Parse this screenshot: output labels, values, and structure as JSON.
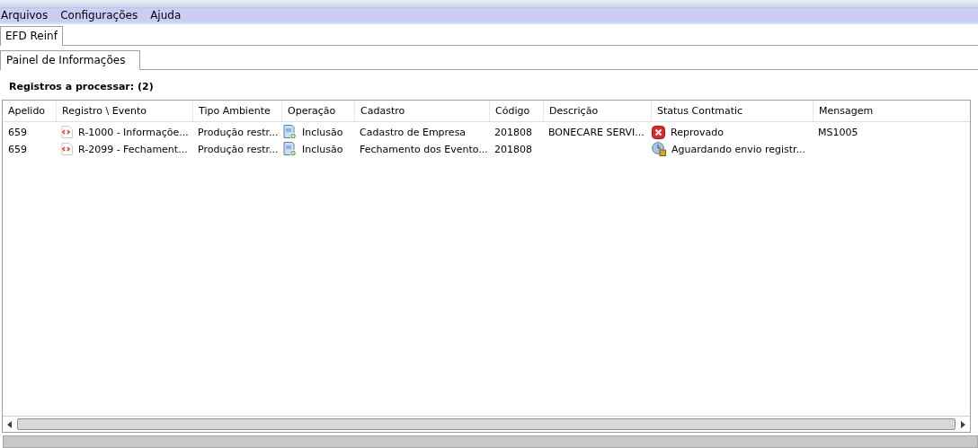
{
  "menu": [
    {
      "label": "Arquivos"
    },
    {
      "label": "Configurações"
    },
    {
      "label": "Ajuda"
    }
  ],
  "main_tabs": [
    {
      "label": "EFD Reinf",
      "selected": true
    }
  ],
  "sub_tabs": [
    {
      "label": "Painel de Informações",
      "selected": true
    }
  ],
  "summary": "Registros a processar: (2)",
  "table": {
    "columns": [
      "Apelido",
      "Registro \\ Evento",
      "Tipo Ambiente",
      "Operação",
      "Cadastro",
      "Código",
      "Descrição",
      "Status Contmatic",
      "Mensagem"
    ],
    "rows": [
      {
        "apelido": "659",
        "evento": "R-1000 - Informaçõe...",
        "ambiente": "Produção restr...",
        "operacao": "Inclusão",
        "cadastro": "Cadastro de Empresa",
        "codigo": "201808",
        "descricao": "BONECARE SERVI...",
        "status": {
          "kind": "error",
          "label": "Reprovado"
        },
        "mensagem": "MS1005"
      },
      {
        "apelido": "659",
        "evento": "R-2099 - Fechament...",
        "ambiente": "Produção restr...",
        "operacao": "Inclusão",
        "cadastro": "Fechamento dos Evento...",
        "codigo": "201808",
        "status": {
          "kind": "waiting",
          "label": "Aguardando envio registr..."
        }
      }
    ]
  }
}
